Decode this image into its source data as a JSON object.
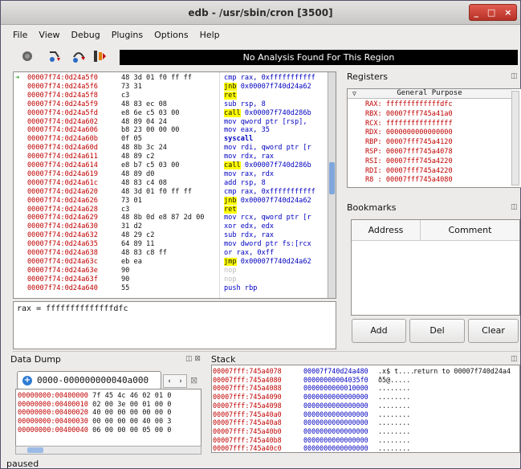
{
  "window": {
    "title": "edb - /usr/sbin/cron [3500]",
    "controls": [
      "_",
      "□",
      "×"
    ]
  },
  "menu": [
    "File",
    "View",
    "Debug",
    "Plugins",
    "Options",
    "Help"
  ],
  "toolbar": {
    "analysis_message": "No Analysis Found For This Region"
  },
  "disasm": {
    "rows": [
      {
        "addr": "00007f74:0d24a5f0",
        "bytes": "48 3d 01 f0 ff ff",
        "mn": "cmp",
        "op": "rax, 0xfffffffffff",
        "cls": "",
        "current": true
      },
      {
        "addr": "00007f74:0d24a5f6",
        "bytes": "73 31",
        "mn": "jnb",
        "op": "0x00007f740d24a62",
        "cls": "jmp"
      },
      {
        "addr": "00007f74:0d24a5f8",
        "bytes": "c3",
        "mn": "ret",
        "op": "",
        "cls": "ret"
      },
      {
        "addr": "00007f74:0d24a5f9",
        "bytes": "48 83 ec 08",
        "mn": "sub",
        "op": "rsp, 8",
        "cls": ""
      },
      {
        "addr": "00007f74:0d24a5fd",
        "bytes": "e8 6e c5 03 00",
        "mn": "call",
        "op": "0x00007f740d286b",
        "cls": "call"
      },
      {
        "addr": "00007f74:0d24a602",
        "bytes": "48 89 04 24",
        "mn": "mov",
        "op": "qword ptr [rsp],",
        "cls": ""
      },
      {
        "addr": "00007f74:0d24a606",
        "bytes": "b8 23 00 00 00",
        "mn": "mov",
        "op": "eax, 35",
        "cls": ""
      },
      {
        "addr": "00007f74:0d24a60b",
        "bytes": "0f 05",
        "mn": "syscall",
        "op": "",
        "cls": "sys"
      },
      {
        "addr": "00007f74:0d24a60d",
        "bytes": "48 8b 3c 24",
        "mn": "mov",
        "op": "rdi, qword ptr [r",
        "cls": ""
      },
      {
        "addr": "00007f74:0d24a611",
        "bytes": "48 89 c2",
        "mn": "mov",
        "op": "rdx, rax",
        "cls": ""
      },
      {
        "addr": "00007f74:0d24a614",
        "bytes": "e8 b7 c5 03 00",
        "mn": "call",
        "op": "0x00007f740d286b",
        "cls": "call"
      },
      {
        "addr": "00007f74:0d24a619",
        "bytes": "48 89 d0",
        "mn": "mov",
        "op": "rax, rdx",
        "cls": ""
      },
      {
        "addr": "00007f74:0d24a61c",
        "bytes": "48 83 c4 08",
        "mn": "add",
        "op": "rsp, 8",
        "cls": ""
      },
      {
        "addr": "00007f74:0d24a620",
        "bytes": "48 3d 01 f0 ff ff",
        "mn": "cmp",
        "op": "rax, 0xfffffffffff",
        "cls": ""
      },
      {
        "addr": "00007f74:0d24a626",
        "bytes": "73 01",
        "mn": "jnb",
        "op": "0x00007f740d24a62",
        "cls": "jmp"
      },
      {
        "addr": "00007f74:0d24a628",
        "bytes": "c3",
        "mn": "ret",
        "op": "",
        "cls": "ret"
      },
      {
        "addr": "00007f74:0d24a629",
        "bytes": "48 8b 0d e8 87 2d 00",
        "mn": "mov",
        "op": "rcx, qword ptr [r",
        "cls": ""
      },
      {
        "addr": "00007f74:0d24a630",
        "bytes": "31 d2",
        "mn": "xor",
        "op": "edx, edx",
        "cls": ""
      },
      {
        "addr": "00007f74:0d24a632",
        "bytes": "48 29 c2",
        "mn": "sub",
        "op": "rdx, rax",
        "cls": ""
      },
      {
        "addr": "00007f74:0d24a635",
        "bytes": "64 89 11",
        "mn": "mov",
        "op": "dword ptr fs:[rcx",
        "cls": ""
      },
      {
        "addr": "00007f74:0d24a638",
        "bytes": "48 83 c8 ff",
        "mn": "or",
        "op": "rax, 0xff",
        "cls": ""
      },
      {
        "addr": "00007f74:0d24a63c",
        "bytes": "eb ea",
        "mn": "jmp",
        "op": "0x00007f740d24a62",
        "cls": "jmp"
      },
      {
        "addr": "00007f74:0d24a63e",
        "bytes": "90",
        "mn": "nop",
        "op": "",
        "cls": "nop"
      },
      {
        "addr": "00007f74:0d24a63f",
        "bytes": "90",
        "mn": "nop",
        "op": "",
        "cls": "nop"
      },
      {
        "addr": "00007f74:0d24a640",
        "bytes": "55",
        "mn": "push",
        "op": "rbp",
        "cls": ""
      }
    ]
  },
  "expression": "rax = ffffffffffffffdfc",
  "registers": {
    "title": "Registers",
    "group": "General Purpose",
    "rows": [
      "RAX: fffffffffffffdfc",
      "RBX: 00007fff745a41a0",
      "RCX: ffffffffffffffff",
      "RDX: 0000000000000000",
      "RBP: 00007fff745a4120",
      "RSP: 00007fff745a4078",
      "RSI: 00007fff745a4220",
      "RDI: 00007fff745a4220",
      "R8 : 00007fff745a4080"
    ]
  },
  "bookmarks": {
    "title": "Bookmarks",
    "col_address": "Address",
    "col_comment": "Comment",
    "add": "Add",
    "del": "Del",
    "clear": "Clear"
  },
  "datadump": {
    "title": "Data Dump",
    "tab": "0000-000000000040a000",
    "rows": [
      {
        "a": "00000000:00400000",
        "h": "7f 45 4c 46 02 01 0"
      },
      {
        "a": "00000000:00400010",
        "h": "02 00 3e 00 01 00 0"
      },
      {
        "a": "00000000:00400020",
        "h": "40 00 00 00 00 00 0"
      },
      {
        "a": "00000000:00400030",
        "h": "00 00 00 00 40 00 3"
      },
      {
        "a": "00000000:00400040",
        "h": "06 00 00 00 05 00 0"
      }
    ]
  },
  "stack": {
    "title": "Stack",
    "rows": [
      {
        "a": "00007fff:745a4078",
        "v": "00007f740d24a480",
        "s": ".x$ t....",
        "c": "return to 00007f740d24a4"
      },
      {
        "a": "00007fff:745a4080",
        "v": "00000000004035f0",
        "s": "ð5@.....",
        "c": ""
      },
      {
        "a": "00007fff:745a4088",
        "v": "0000000000010000",
        "s": "........",
        "c": ""
      },
      {
        "a": "00007fff:745a4090",
        "v": "0000000000000000",
        "s": "........",
        "c": ""
      },
      {
        "a": "00007fff:745a4098",
        "v": "0000000000000000",
        "s": "........",
        "c": ""
      },
      {
        "a": "00007fff:745a40a0",
        "v": "0000000000000000",
        "s": "........",
        "c": ""
      },
      {
        "a": "00007fff:745a40a8",
        "v": "0000000000000000",
        "s": "........",
        "c": ""
      },
      {
        "a": "00007fff:745a40b0",
        "v": "0000000000000000",
        "s": "........",
        "c": ""
      },
      {
        "a": "00007fff:745a40b8",
        "v": "0000000000000000",
        "s": "........",
        "c": ""
      },
      {
        "a": "00007fff:745a40c0",
        "v": "0000000000000000",
        "s": "........",
        "c": ""
      }
    ]
  },
  "status": "paused"
}
